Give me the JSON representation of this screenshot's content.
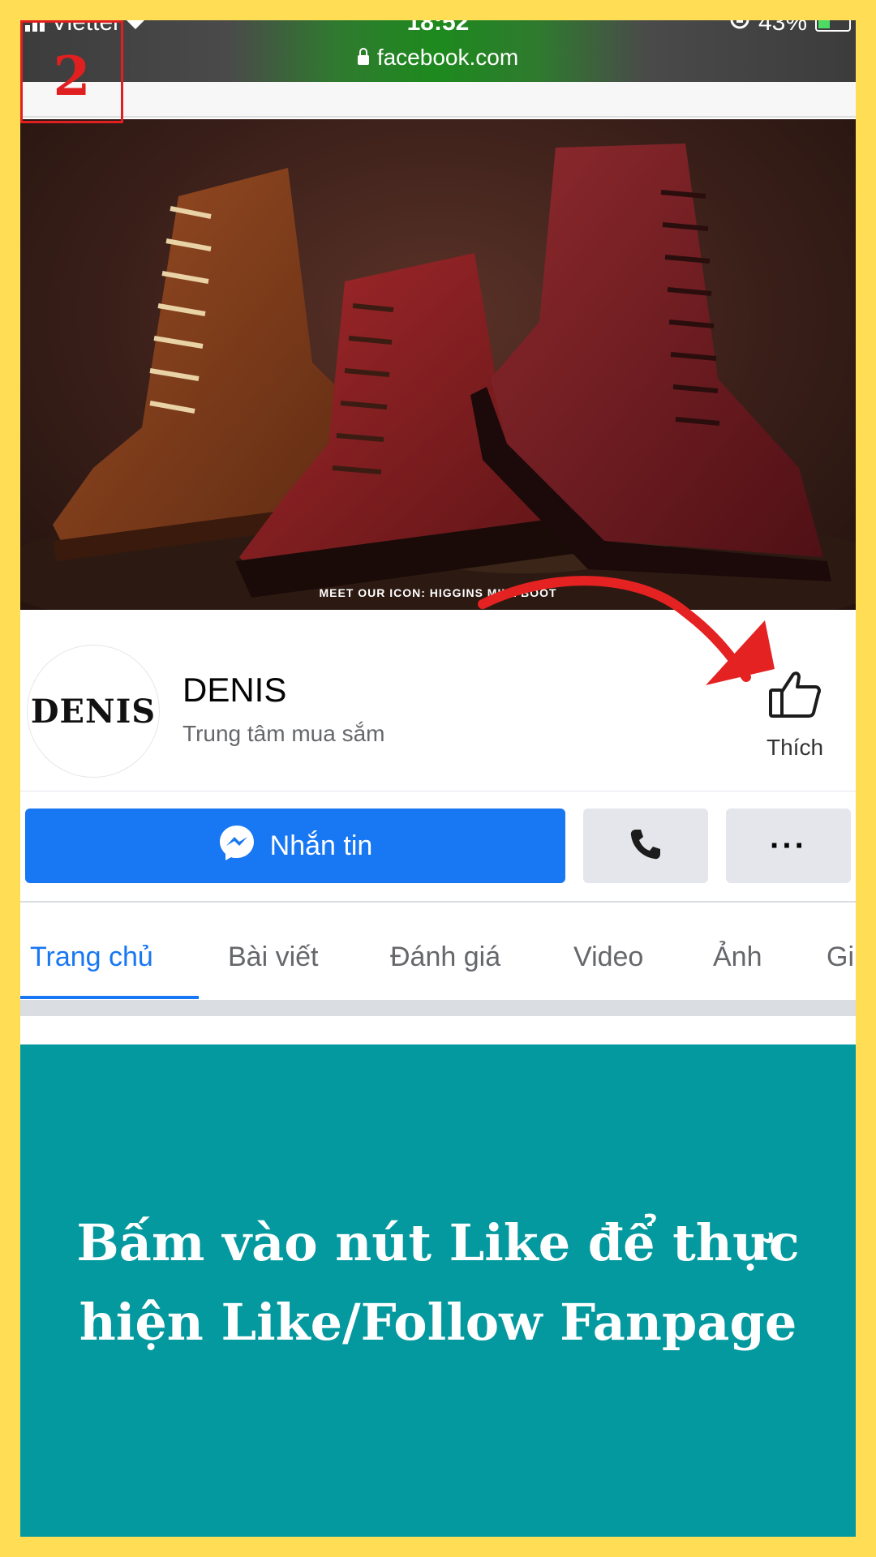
{
  "status_bar": {
    "carrier": "Viettel",
    "time": "18:52",
    "battery": "43%"
  },
  "browser": {
    "url": "facebook.com"
  },
  "step": {
    "number": "2"
  },
  "cover": {
    "caption": "MEET OUR ICON: HIGGINS MILL BOOT"
  },
  "page": {
    "avatar_text": "DENIS",
    "name": "DENIS",
    "category": "Trung tâm mua sắm",
    "like_label": "Thích"
  },
  "actions": {
    "message_label": "Nhắn tin",
    "call_icon": "phone-icon",
    "more_label": "···"
  },
  "tabs": [
    {
      "label": "Trang chủ",
      "active": true
    },
    {
      "label": "Bài viết",
      "active": false
    },
    {
      "label": "Đánh giá",
      "active": false
    },
    {
      "label": "Video",
      "active": false
    },
    {
      "label": "Ảnh",
      "active": false
    },
    {
      "label": "Gi",
      "active": false
    }
  ],
  "instruction": {
    "line1": "Bấm vào nút Like để thực",
    "line2": "hiện Like/Follow Fanpage"
  },
  "colors": {
    "frame": "#FFDD55",
    "brand_blue": "#1877f2",
    "teal": "#03999f",
    "arrow_red": "#e52222"
  }
}
